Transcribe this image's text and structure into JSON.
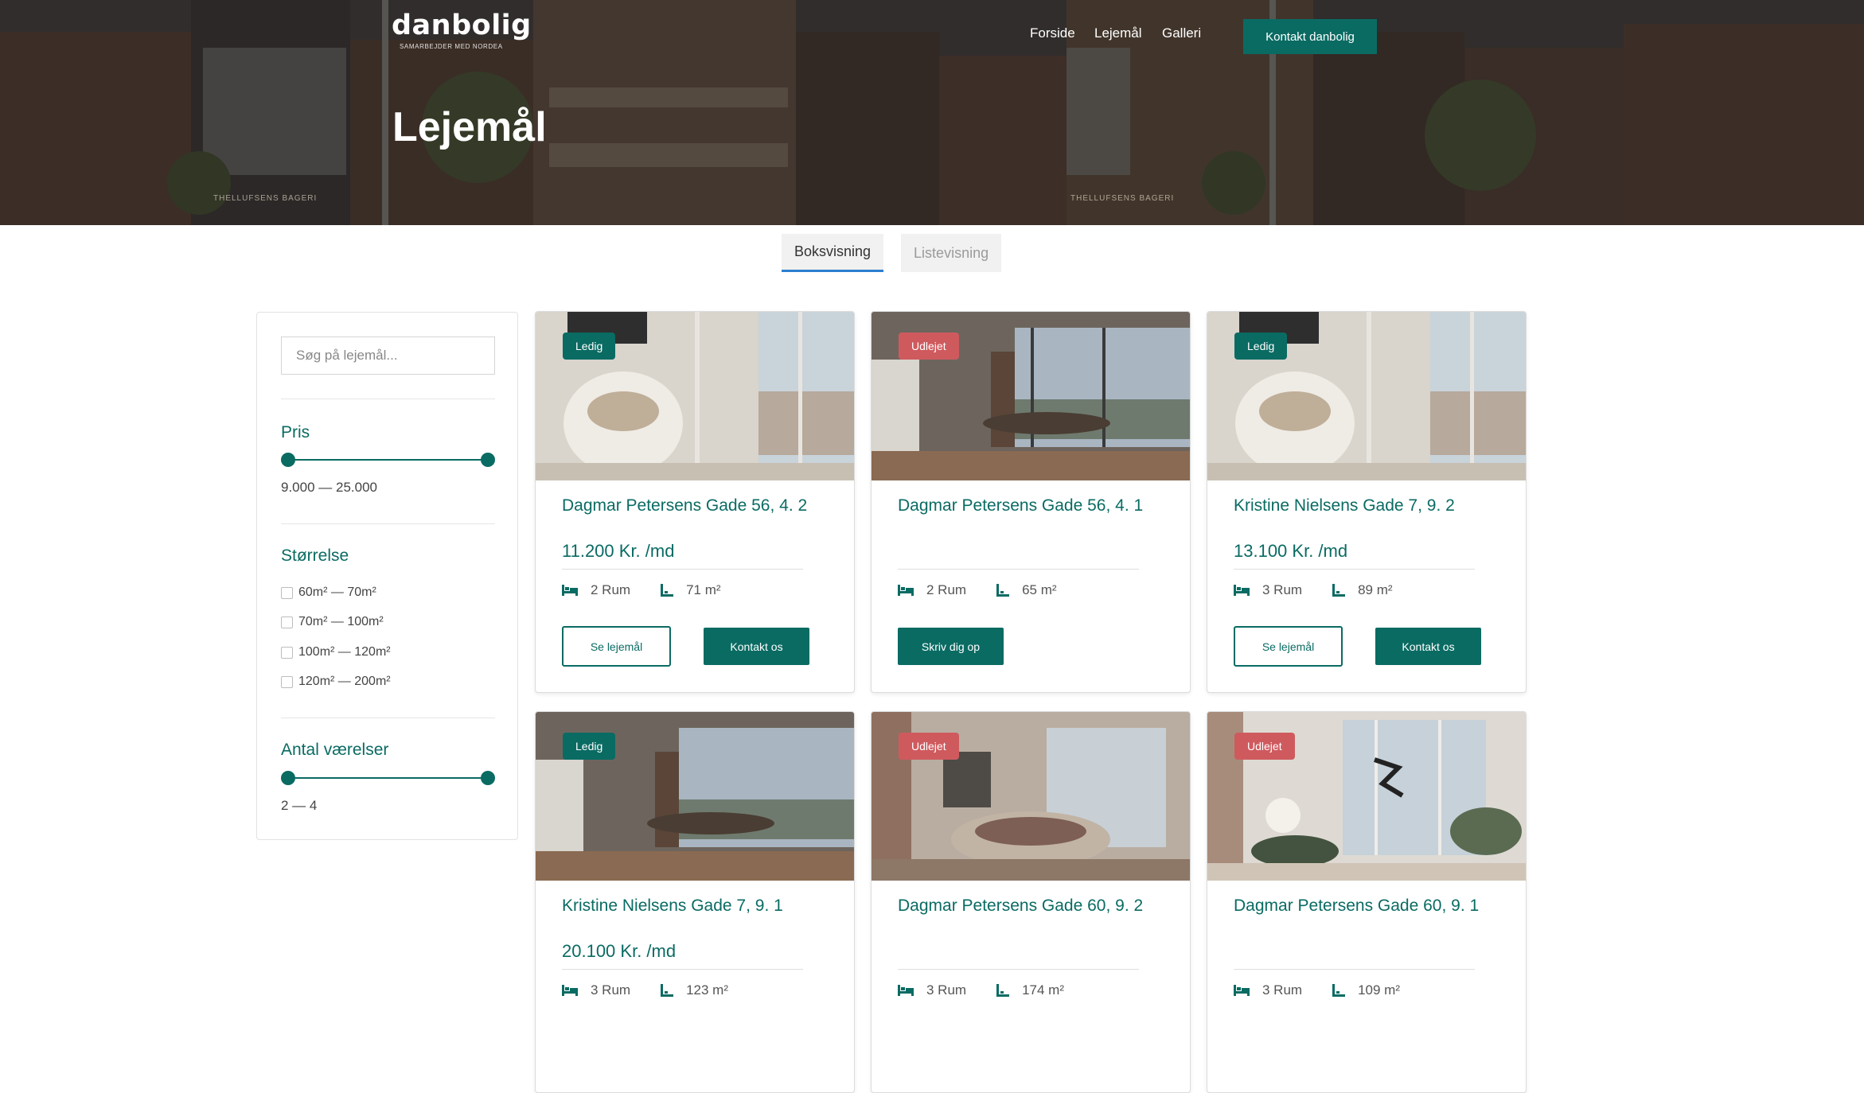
{
  "header": {
    "logo_name": "danbolig",
    "logo_sub": "SAMARBEJDER MED NORDEA",
    "nav": [
      "Forside",
      "Lejemål",
      "Galleri"
    ],
    "contact_button": "Kontakt danbolig",
    "page_title": "Lejemål",
    "building_sign": "THELLUFSENS BAGERI"
  },
  "view_tabs": {
    "active": "Boksvisning",
    "inactive": "Listevisning"
  },
  "sidebar": {
    "search_placeholder": "Søg på lejemål...",
    "price": {
      "title": "Pris",
      "range_text": "9.000 — 25.000",
      "min": 9000,
      "max": 25000
    },
    "size": {
      "title": "Størrelse",
      "options": [
        "60m² — 70m²",
        "70m² — 100m²",
        "100m² — 120m²",
        "120m² — 200m²"
      ]
    },
    "rooms": {
      "title": "Antal værelser",
      "range_text": "2 — 4",
      "min": 2,
      "max": 4
    }
  },
  "listings": [
    {
      "status": "Ledig",
      "address": "Dagmar Petersens Gade 56, 4. 2",
      "price": "11.200 Kr. /md",
      "rooms": "2 Rum",
      "area": "71 m²",
      "btn_view": "Se lejemål",
      "btn_contact": "Kontakt os"
    },
    {
      "status": "Udlejet",
      "address": "Dagmar Petersens Gade 56, 4. 1",
      "price": "",
      "rooms": "2 Rum",
      "area": "65 m²",
      "btn_signup": "Skriv dig op"
    },
    {
      "status": "Ledig",
      "address": "Kristine Nielsens Gade 7, 9. 2",
      "price": "13.100 Kr. /md",
      "rooms": "3 Rum",
      "area": "89 m²",
      "btn_view": "Se lejemål",
      "btn_contact": "Kontakt os"
    },
    {
      "status": "Ledig",
      "address": "Kristine Nielsens Gade 7, 9. 1",
      "price": "20.100 Kr. /md",
      "rooms": "3 Rum",
      "area": "123 m²"
    },
    {
      "status": "Udlejet",
      "address": "Dagmar Petersens Gade 60, 9. 2",
      "price": "",
      "rooms": "3 Rum",
      "area": "174 m²"
    },
    {
      "status": "Udlejet",
      "address": "Dagmar Petersens Gade 60, 9. 1",
      "price": "",
      "rooms": "3 Rum",
      "area": "109 m²"
    }
  ],
  "colors": {
    "accent": "#0a6b63",
    "rented": "#cf5a5e",
    "tab_underline": "#2c7fd1"
  },
  "icons": {
    "rooms": "bed-icon",
    "area": "floor-area-icon"
  }
}
